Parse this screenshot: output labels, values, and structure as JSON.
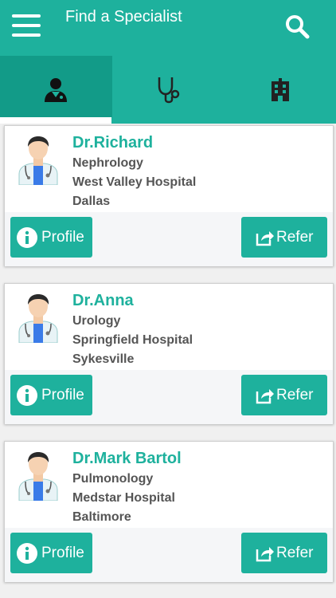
{
  "app": {
    "title": "Find a Specialist"
  },
  "tabs": [
    {
      "icon": "doctor-icon"
    },
    {
      "icon": "stethoscope-icon"
    },
    {
      "icon": "hospital-icon"
    }
  ],
  "specialists": [
    {
      "name": "Dr.Richard",
      "specialty": "Nephrology",
      "hospital": "West Valley Hospital",
      "city": "Dallas"
    },
    {
      "name": "Dr.Anna",
      "specialty": "Urology",
      "hospital": "Springfield Hospital",
      "city": "Sykesville"
    },
    {
      "name": "Dr.Mark Bartol",
      "specialty": "Pulmonology",
      "hospital": "Medstar Hospital",
      "city": "Baltimore"
    }
  ],
  "buttons": {
    "profile": "Profile",
    "refer": "Refer"
  },
  "colors": {
    "primary": "#1eb19d",
    "primary_dark": "#129b88",
    "text_secondary": "#555555"
  }
}
